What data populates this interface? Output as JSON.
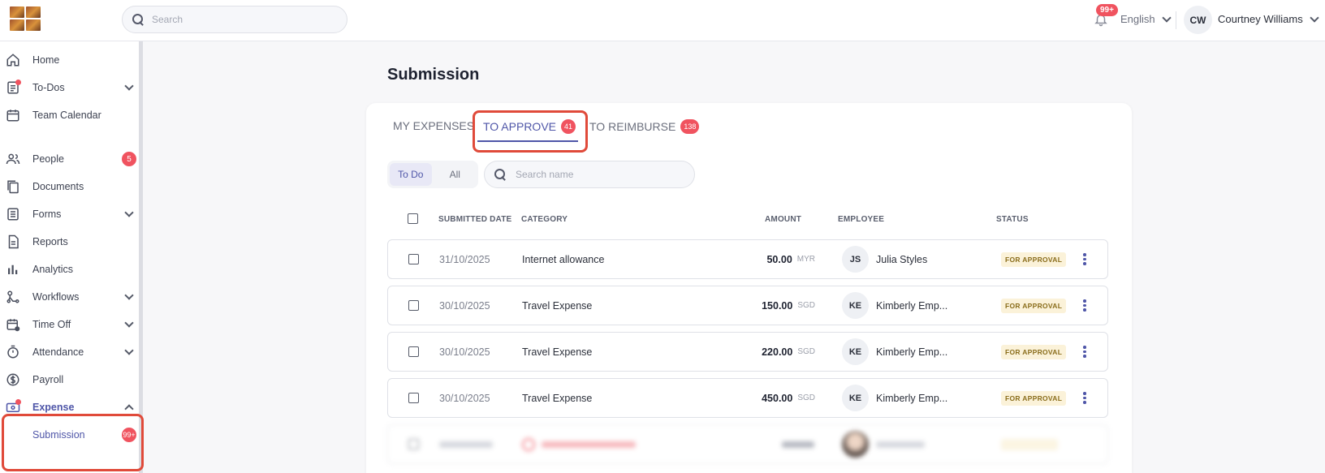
{
  "topbar": {
    "search_placeholder": "Search",
    "notifications_badge": "99+",
    "language": "English",
    "user_initials": "CW",
    "user_name": "Courtney Williams"
  },
  "sidebar": {
    "items": [
      {
        "label": "Home",
        "icon": "home-icon"
      },
      {
        "label": "To-Dos",
        "icon": "checklist-icon",
        "chevron": true,
        "dot": true
      },
      {
        "label": "Team Calendar",
        "icon": "calendar-icon"
      },
      {
        "label": "People",
        "icon": "people-icon",
        "badge": "5"
      },
      {
        "label": "Documents",
        "icon": "documents-icon"
      },
      {
        "label": "Forms",
        "icon": "forms-icon",
        "chevron": true
      },
      {
        "label": "Reports",
        "icon": "reports-icon"
      },
      {
        "label": "Analytics",
        "icon": "analytics-icon"
      },
      {
        "label": "Workflows",
        "icon": "workflows-icon",
        "chevron": true
      },
      {
        "label": "Time Off",
        "icon": "time-off-icon",
        "chevron": true
      },
      {
        "label": "Attendance",
        "icon": "stopwatch-icon",
        "chevron": true
      },
      {
        "label": "Payroll",
        "icon": "dollar-icon"
      },
      {
        "label": "Expense",
        "icon": "wallet-icon",
        "chevron": true,
        "dot": true,
        "active": true
      }
    ],
    "subitems": [
      {
        "label": "Submission",
        "badge": "99+"
      }
    ]
  },
  "main": {
    "title": "Submission",
    "tabs": [
      {
        "label": "MY EXPENSES"
      },
      {
        "label": "TO APPROVE",
        "badge": "41"
      },
      {
        "label": "TO REIMBURSE",
        "badge": "138"
      }
    ],
    "filter": {
      "todo": "To Do",
      "all": "All"
    },
    "search_placeholder": "Search name",
    "columns": {
      "date": "SUBMITTED DATE",
      "category": "CATEGORY",
      "amount": "AMOUNT",
      "employee": "EMPLOYEE",
      "status": "STATUS"
    },
    "rows": [
      {
        "date": "31/10/2025",
        "category": "Internet allowance",
        "amount": "50.00",
        "currency": "MYR",
        "initials": "JS",
        "employee": "Julia Styles",
        "status": "FOR APPROVAL"
      },
      {
        "date": "30/10/2025",
        "category": "Travel Expense",
        "amount": "150.00",
        "currency": "SGD",
        "initials": "KE",
        "employee": "Kimberly Emp...",
        "status": "FOR APPROVAL"
      },
      {
        "date": "30/10/2025",
        "category": "Travel Expense",
        "amount": "220.00",
        "currency": "SGD",
        "initials": "KE",
        "employee": "Kimberly Emp...",
        "status": "FOR APPROVAL"
      },
      {
        "date": "30/10/2025",
        "category": "Travel Expense",
        "amount": "450.00",
        "currency": "SGD",
        "initials": "KE",
        "employee": "Kimberly Emp...",
        "status": "FOR APPROVAL"
      }
    ]
  },
  "colors": {
    "accent": "#4f56a8",
    "badge": "#f0535f",
    "highlight": "#e04a3a",
    "status_bg": "#fbf2d9"
  }
}
